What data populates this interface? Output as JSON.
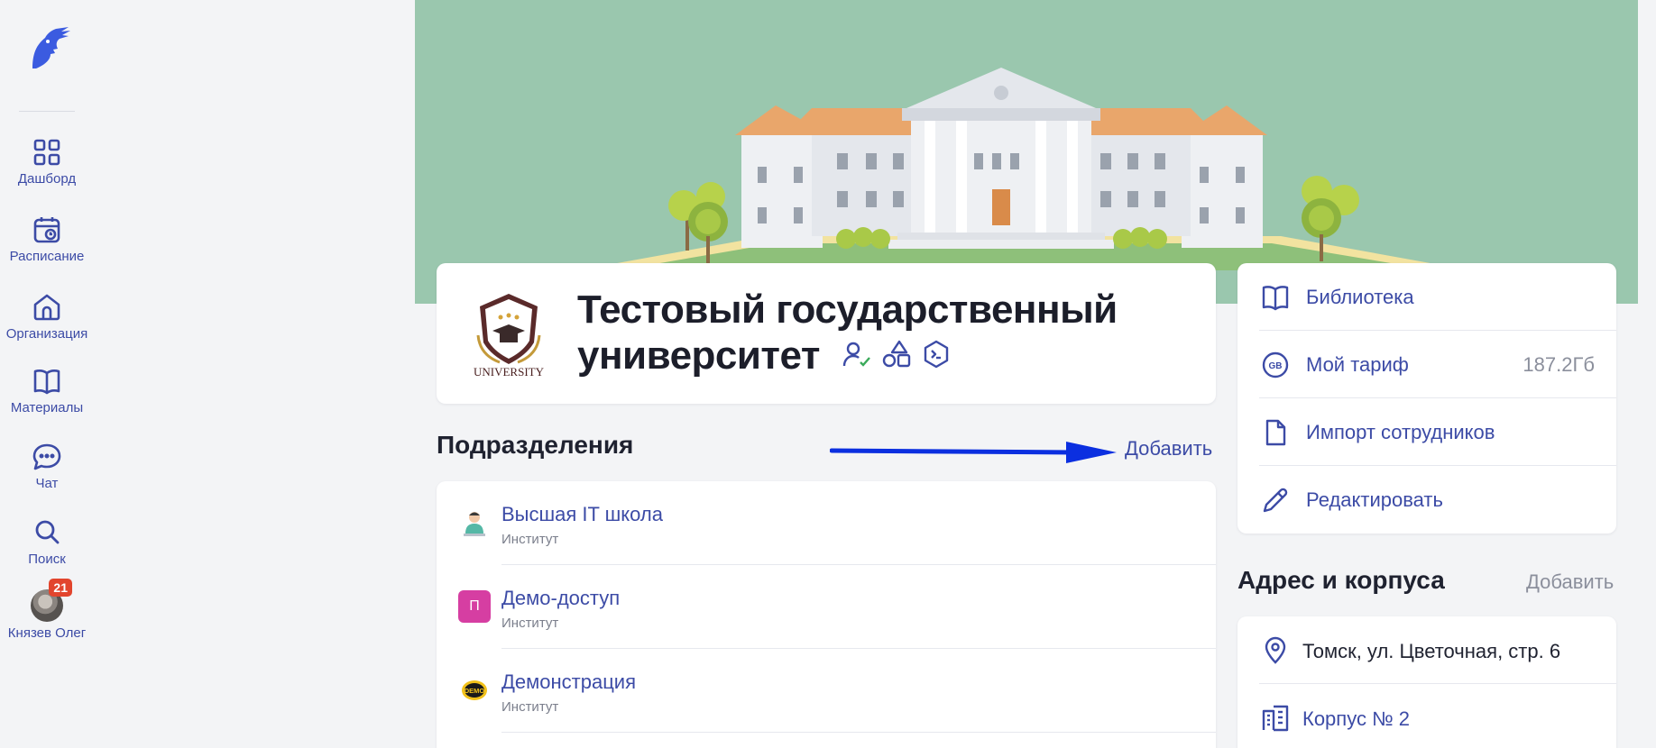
{
  "sidebar": {
    "items": [
      {
        "label": "Дашборд",
        "icon": "dashboard-icon"
      },
      {
        "label": "Расписание",
        "icon": "calendar-icon"
      },
      {
        "label": "Организация",
        "icon": "home-icon"
      },
      {
        "label": "Материалы",
        "icon": "book-icon"
      },
      {
        "label": "Чат",
        "icon": "chat-icon"
      },
      {
        "label": "Поиск",
        "icon": "search-icon"
      }
    ],
    "user": {
      "name": "Князев Олег",
      "badge": "21"
    }
  },
  "org": {
    "title": "Тестовый государственный университет",
    "logo_text": "UNIVERSITY"
  },
  "divisions": {
    "title": "Подразделения",
    "add_label": "Добавить",
    "items": [
      {
        "name": "Высшая IT школа",
        "type": "Институт",
        "icon": "avatar-icon"
      },
      {
        "name": "Демо-доступ",
        "type": "Институт",
        "icon_letter": "П",
        "icon_color": "#d63ea2"
      },
      {
        "name": "Демонстрация",
        "type": "Институт",
        "icon_text": "DEMO"
      }
    ]
  },
  "right_menu": {
    "items": [
      {
        "label": "Библиотека",
        "icon": "book-icon"
      },
      {
        "label": "Мой тариф",
        "icon": "gb-icon",
        "icon_text": "GB",
        "value": "187.2Гб"
      },
      {
        "label": "Импорт сотрудников",
        "icon": "file-icon"
      },
      {
        "label": "Редактировать",
        "icon": "pencil-icon"
      }
    ]
  },
  "address": {
    "title": "Адрес и корпуса",
    "add_label": "Добавить",
    "items": [
      {
        "label": "Томск, ул. Цветочная, стр. 6",
        "icon": "location-icon"
      },
      {
        "label": "Корпус № 2",
        "icon": "building-icon"
      }
    ]
  },
  "colors": {
    "accent": "#3c4ba6",
    "banner": "#9ac7ae",
    "badge": "#e2452d",
    "arrow": "#0b2fe0"
  }
}
